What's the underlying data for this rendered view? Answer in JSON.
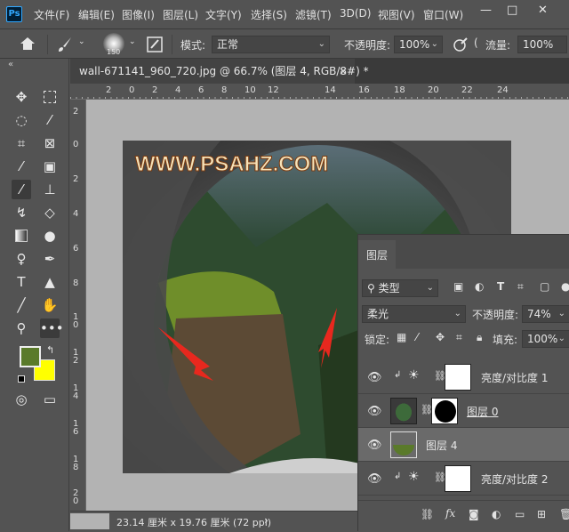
{
  "menubar": {
    "logo": "Ps",
    "items": [
      "文件(F)",
      "编辑(E)",
      "图像(I)",
      "图层(L)",
      "文字(Y)",
      "选择(S)",
      "滤镜(T)",
      "3D(D)",
      "视图(V)",
      "窗口(W)"
    ],
    "window_buttons": [
      "—",
      "□",
      "✕"
    ]
  },
  "options": {
    "brush_size": "150",
    "mode_label": "模式:",
    "mode_value": "正常",
    "opacity_label": "不透明度:",
    "opacity_value": "100%",
    "flow_label": "流量:",
    "flow_value": "100%"
  },
  "document": {
    "tab_title": "wall-671141_960_720.jpg @ 66.7% (图层 4, RGB/8#) *",
    "close": "×",
    "ruler_top_ticks": [
      "2",
      "0",
      "2",
      "4",
      "6",
      "8",
      "10",
      "12",
      "14",
      "16",
      "18",
      "20",
      "22",
      "24"
    ],
    "ruler_left_ticks": [
      "2",
      "0",
      "2",
      "4",
      "6",
      "8",
      "1 0",
      "1 2",
      "1 4",
      "1 6",
      "1 8",
      "2 0"
    ],
    "watermark": "WWW.PSAHZ.COM",
    "status": "23.14 厘米 x 19.76 厘米 (72 ppi)",
    "status_arrow": "›"
  },
  "colors": {
    "foreground": "#5a7a2a",
    "background": "#ffff00",
    "arrow_red": "#e8281e",
    "panel_bg": "#535353"
  },
  "layers_panel": {
    "title": "图层",
    "filter_label": "类型",
    "blend_mode": "柔光",
    "opacity_label": "不透明度:",
    "opacity_value": "74%",
    "lock_label": "锁定:",
    "fill_label": "填充:",
    "fill_value": "100%",
    "layers": [
      {
        "name": "亮度/对比度 1",
        "type": "adjustment",
        "selected": false
      },
      {
        "name": "图层 0",
        "type": "masked",
        "selected": false
      },
      {
        "name": "图层 4",
        "type": "pixel",
        "selected": true
      },
      {
        "name": "亮度/对比度 2",
        "type": "adjustment",
        "selected": false
      }
    ],
    "footer_icons": [
      "link-icon",
      "fx-icon",
      "mask-icon",
      "adjustment-icon",
      "group-icon",
      "new-layer-icon",
      "delete-icon"
    ],
    "fx_label": "fx"
  }
}
